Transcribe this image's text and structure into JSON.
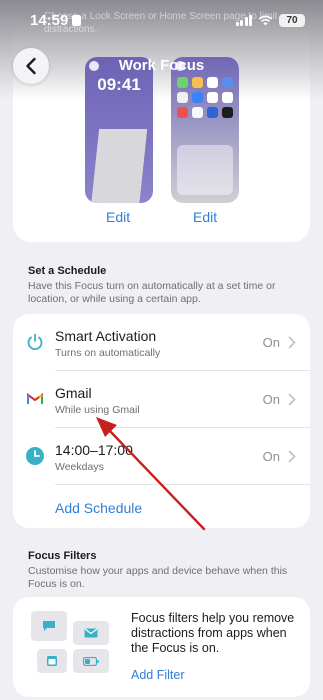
{
  "status_bar": {
    "time": "14:59",
    "battery": "70"
  },
  "header": {
    "faded_text": "Choose a Lock Screen or Home Screen page to limit distractions.",
    "title": "Work Focus"
  },
  "preview": {
    "lock_clock": "09:41",
    "lock_edit_label": "Edit",
    "home_edit_label": "Edit"
  },
  "schedule_section": {
    "heading": "Set a Schedule",
    "description": "Have this Focus turn on automatically at a set time or location, or while using a certain app.",
    "rows": [
      {
        "title": "Smart Activation",
        "subtitle": "Turns on automatically",
        "state": "On",
        "icon": "power-icon"
      },
      {
        "title": "Gmail",
        "subtitle": "While using Gmail",
        "state": "On",
        "icon": "gmail-icon"
      },
      {
        "title": "14:00–17:00",
        "subtitle": "Weekdays",
        "state": "On",
        "icon": "clock-icon"
      }
    ],
    "add_label": "Add Schedule"
  },
  "filters_section": {
    "heading": "Focus Filters",
    "description": "Customise how your apps and device behave when this Focus is on.",
    "card_text": "Focus filters help you remove distractions from apps when the Focus is on.",
    "add_label": "Add Filter"
  },
  "colors": {
    "accent": "#2f7ed8",
    "annotation_arrow": "#c8201e",
    "clock_icon": "#3ab0c8"
  }
}
